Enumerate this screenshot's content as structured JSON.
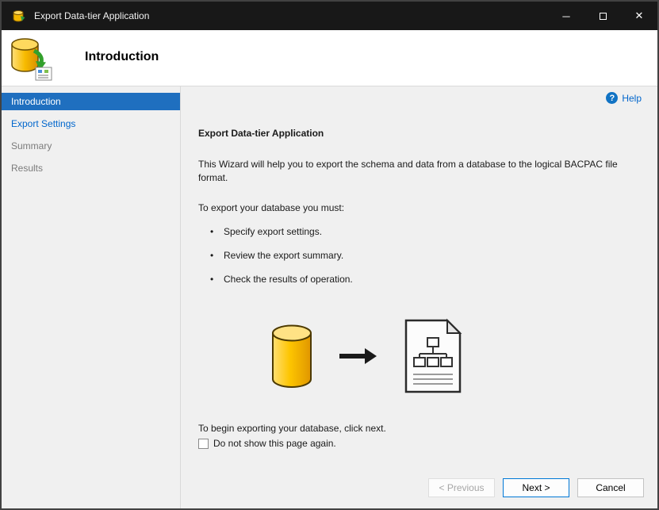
{
  "window": {
    "title": "Export Data-tier Application",
    "controls": {
      "minimize": "─",
      "close": "✕"
    }
  },
  "header": {
    "title": "Introduction"
  },
  "sidebar": {
    "items": [
      {
        "label": "Introduction",
        "state": "selected"
      },
      {
        "label": "Export Settings",
        "state": "enabled-link"
      },
      {
        "label": "Summary",
        "state": "disabled"
      },
      {
        "label": "Results",
        "state": "disabled"
      }
    ]
  },
  "main": {
    "help_label": "Help",
    "help_icon": "?",
    "heading": "Export Data-tier Application",
    "intro": "This Wizard will help you to export the schema and data from a database to the logical BACPAC file format.",
    "requirements_label": "To export your database you must:",
    "bullet_glyph": "•",
    "bullets": [
      "Specify export settings.",
      "Review the export summary.",
      "Check the results of operation."
    ],
    "begin_text": "To begin exporting your database, click next.",
    "checkbox_label": "Do not show this page again.",
    "checkbox_checked": false
  },
  "footer": {
    "previous_label": "< Previous",
    "next_label": "Next >",
    "cancel_label": "Cancel"
  },
  "colors": {
    "titlebar_bg": "#181818",
    "content_bg": "#f0f0f0",
    "selected_step_blue": "#1f6fbf",
    "link_blue": "#0066cc",
    "next_button_border": "#0078d7",
    "database_yellow": "#fdc500",
    "arrow_green": "#33a02c"
  }
}
